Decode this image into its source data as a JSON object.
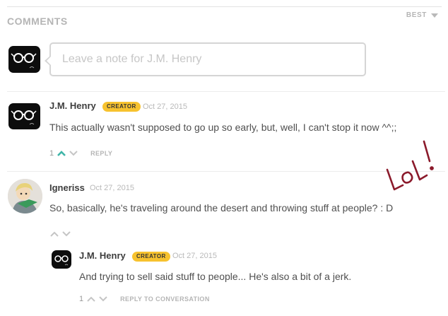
{
  "section": {
    "title": "COMMENTS",
    "sort_label": "BEST"
  },
  "note": {
    "placeholder": "Leave a note for J.M. Henry"
  },
  "comments": [
    {
      "author": "J.M. Henry",
      "badge": "CREATOR",
      "date": "Oct 27, 2015",
      "text": "This actually wasn't supposed to go up so early, but, well, I can't stop it now ^^;;",
      "votes": "1",
      "reply_label": "REPLY",
      "upvoted": true
    },
    {
      "author": "Igneriss",
      "date": "Oct 27, 2015",
      "text": "So, basically, he's traveling around the desert and throwing stuff at people? : D",
      "reply": {
        "author": "J.M. Henry",
        "badge": "CREATOR",
        "date": "Oct 27, 2015",
        "text": "And trying to sell said stuff to people... He's also a bit of a jerk.",
        "votes": "1",
        "reply_label": "REPLY TO CONVERSATION"
      }
    }
  ],
  "annotation": {
    "text": "LoL!",
    "color": "#8b1a2b"
  },
  "colors": {
    "upvote_active": "#3fb5a8",
    "badge": "#f7c22e"
  }
}
